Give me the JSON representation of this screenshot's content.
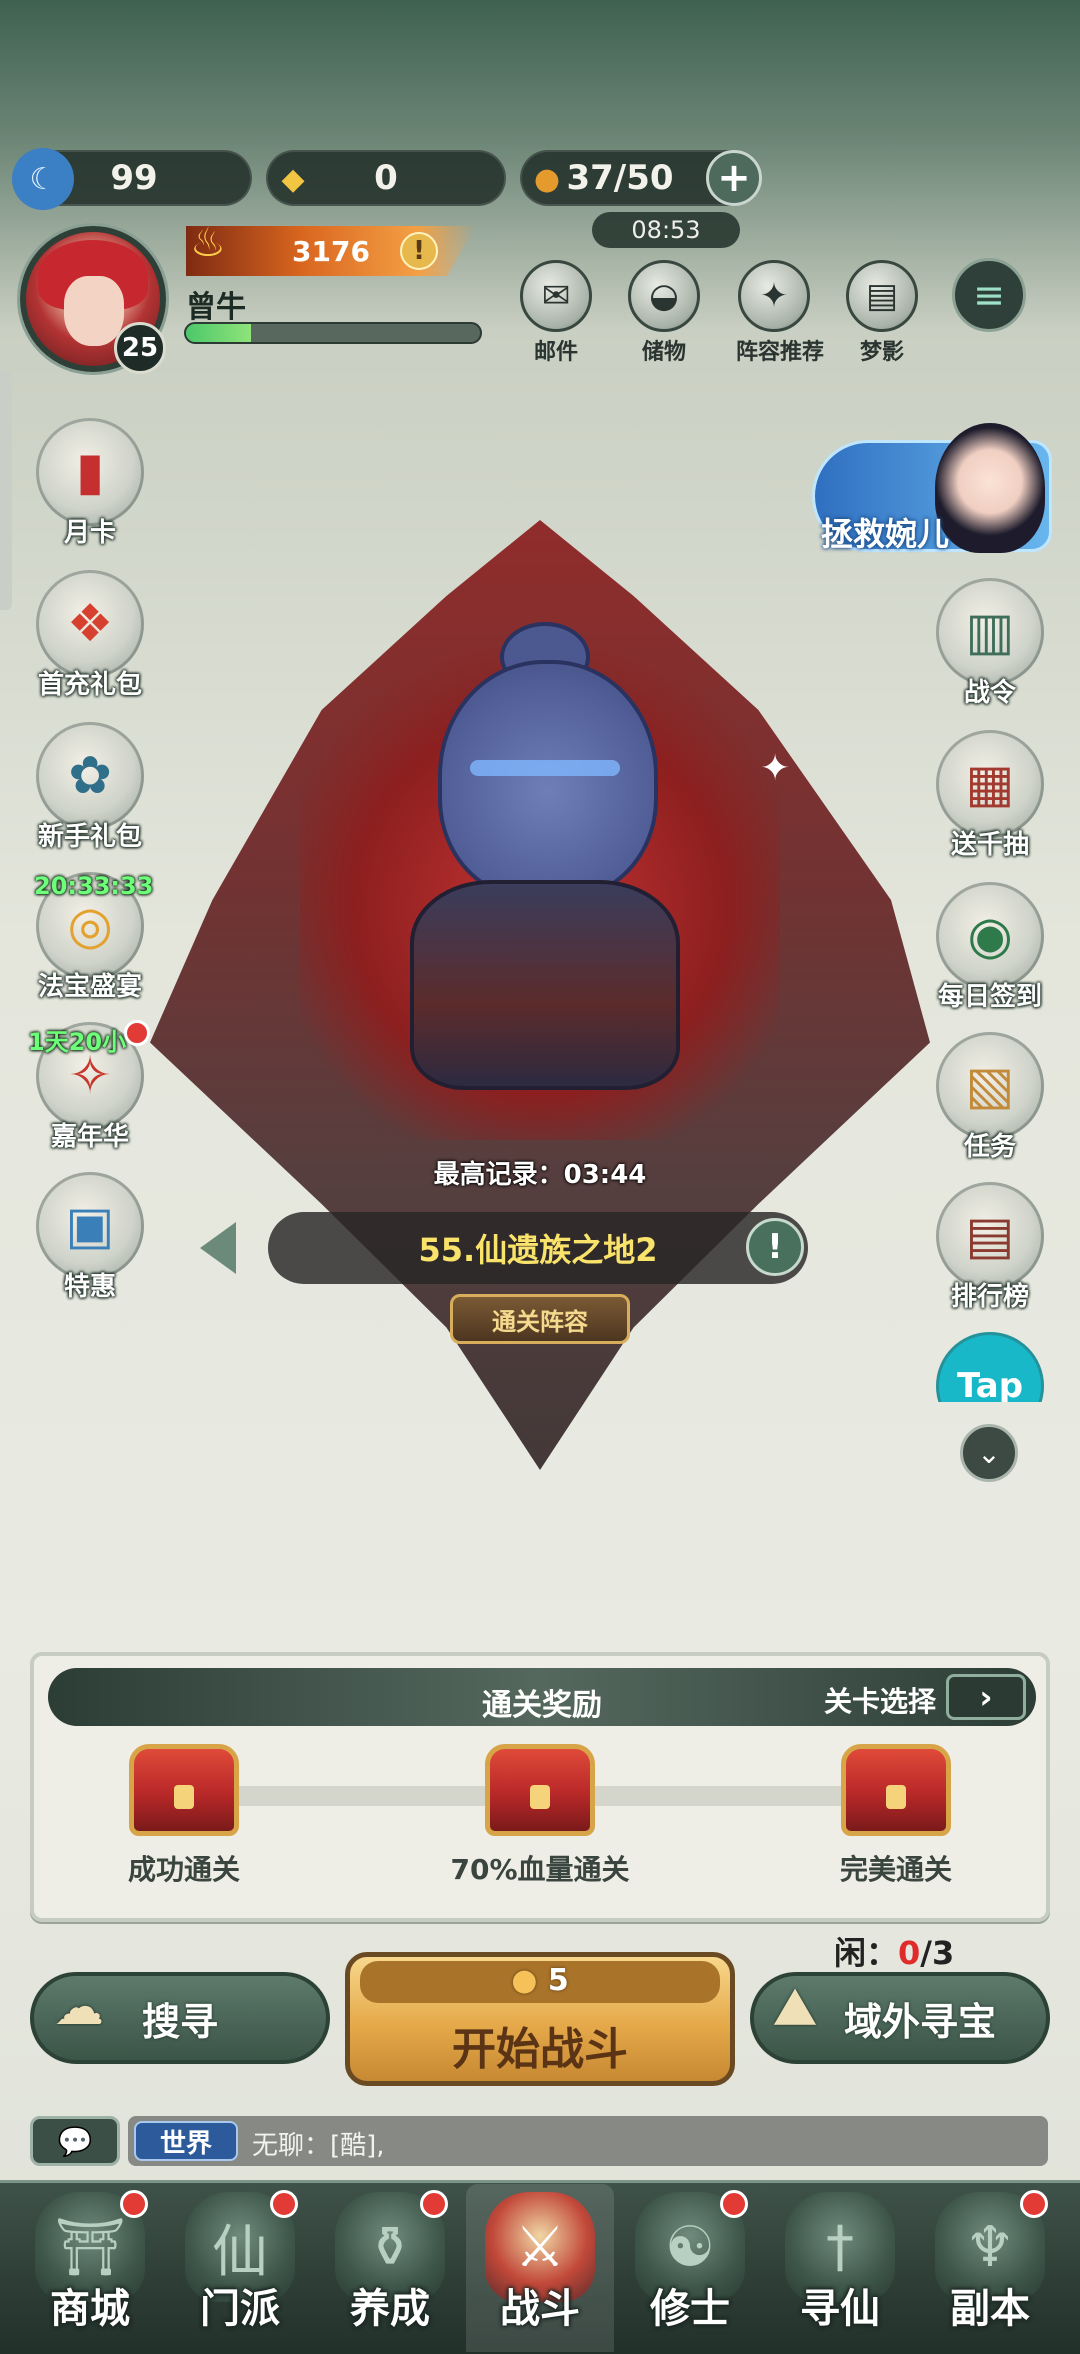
{
  "currencies": [
    {
      "icon": "moon-token-icon",
      "value": "99"
    },
    {
      "icon": "ticket-icon",
      "value": "0"
    },
    {
      "icon": "gourd-icon",
      "value": "37/50"
    }
  ],
  "energy_timer": "08:53",
  "player": {
    "name": "曾牛",
    "level": "25",
    "power": "3176",
    "exp_progress": 0.22
  },
  "top_buttons": [
    {
      "icon": "mail-icon",
      "label": "邮件"
    },
    {
      "icon": "bag-icon",
      "label": "储物"
    },
    {
      "icon": "sparkle-icon",
      "label": "阵容推荐"
    },
    {
      "icon": "scroll-icon",
      "label": "梦影"
    }
  ],
  "left_buttons": [
    {
      "icon": "month-card-icon",
      "label": "月卡"
    },
    {
      "icon": "gift-pack-icon",
      "label": "首充礼包"
    },
    {
      "icon": "newbie-pack-icon",
      "label": "新手礼包"
    },
    {
      "icon": "treasure-feast-icon",
      "label": "法宝盛宴",
      "timer": "20:33:33"
    },
    {
      "icon": "carnival-icon",
      "label": "嘉年华",
      "timer": "1天20小"
    },
    {
      "icon": "special-offer-icon",
      "label": "特惠"
    }
  ],
  "right_buttons": [
    {
      "icon": "battle-pass-icon",
      "label": "战令"
    },
    {
      "icon": "thousand-draw-icon",
      "label": "送千抽"
    },
    {
      "icon": "daily-signin-icon",
      "label": "每日签到"
    },
    {
      "icon": "quest-icon",
      "label": "任务"
    },
    {
      "icon": "ranking-icon",
      "label": "排行榜"
    },
    {
      "icon": "taptap-icon",
      "label": "Tap"
    }
  ],
  "rescue_banner": "拯救婉儿",
  "stage": {
    "record": "最高记录：03:44",
    "name": "55.仙遗族之地2",
    "lineup_button": "通关阵容"
  },
  "rewards": {
    "title": "通关奖励",
    "select_label": "关卡选择",
    "items": [
      {
        "label": "成功通关"
      },
      {
        "label": "70%血量通关"
      },
      {
        "label": "完美通关"
      }
    ]
  },
  "actions": {
    "search": "搜寻",
    "start": "开始战斗",
    "start_cost": "5",
    "outer": "域外寻宝",
    "idle_label": "闲：",
    "idle_current": "0",
    "idle_total": "/3"
  },
  "chat": {
    "channel": "世界",
    "message": "无聊：[酷],"
  },
  "bottom_nav": [
    {
      "label": "商城"
    },
    {
      "label": "门派"
    },
    {
      "label": "养成"
    },
    {
      "label": "战斗"
    },
    {
      "label": "修士"
    },
    {
      "label": "寻仙"
    },
    {
      "label": "副本"
    }
  ]
}
